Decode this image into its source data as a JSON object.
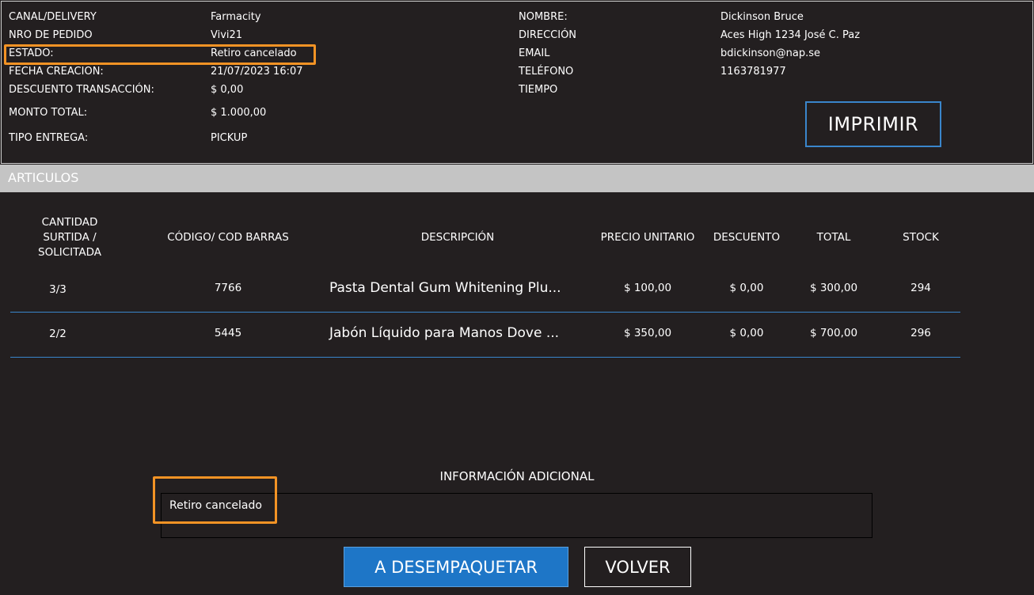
{
  "order": {
    "canal_label": "CANAL/DELIVERY",
    "canal_value": "Farmacity",
    "nro_label": "NRO DE PEDIDO",
    "nro_value": "Vivi21",
    "estado_label": "ESTADO:",
    "estado_value": "Retiro cancelado",
    "fecha_label": "FECHA CREACION:",
    "fecha_value": "21/07/2023 16:07",
    "descuento_label": "DESCUENTO TRANSACCIÓN:",
    "descuento_value": "$ 0,00",
    "monto_label": "MONTO TOTAL:",
    "monto_value": "$ 1.000,00",
    "tipo_label": "TIPO ENTREGA:",
    "tipo_value": "PICKUP"
  },
  "customer": {
    "nombre_label": "NOMBRE:",
    "nombre_value": "Dickinson Bruce",
    "direccion_label": "DIRECCIÓN",
    "direccion_value": "Aces High 1234 José C. Paz",
    "email_label": "EMAIL",
    "email_value": "bdickinson@nap.se",
    "telefono_label": "TELÉFONO",
    "telefono_value": "1163781977",
    "tiempo_label": "TIEMPO"
  },
  "print_button": "IMPRIMIR",
  "articles": {
    "section_title": "ARTICULOS",
    "headers": {
      "cantidad_1": "CANTIDAD",
      "cantidad_2": "SURTIDA /",
      "cantidad_3": "SOLICITADA",
      "codigo": "CÓDIGO/ COD BARRAS",
      "descripcion": "DESCRIPCIÓN",
      "precio": "PRECIO UNITARIO",
      "descuento": "DESCUENTO",
      "total": "TOTAL",
      "stock": "STOCK"
    },
    "rows": [
      {
        "cantidad": "3/3",
        "codigo": "7766",
        "descripcion": "Pasta Dental Gum Whitening Plu...",
        "precio": "$ 100,00",
        "descuento": "$ 0,00",
        "total": "$ 300,00",
        "stock": "294"
      },
      {
        "cantidad": "2/2",
        "codigo": "5445",
        "descripcion": "Jabón Líquido para Manos Dove ...",
        "precio": "$ 350,00",
        "descuento": "$ 0,00",
        "total": "$ 700,00",
        "stock": "296"
      }
    ]
  },
  "notes": {
    "label": "INFORMACIÓN ADICIONAL",
    "text": "Retiro cancelado"
  },
  "actions": {
    "unpack": "A DESEMPAQUETAR",
    "back": "VOLVER"
  },
  "colors": {
    "background": "#231f20",
    "highlight": "#f39325",
    "accent": "#1e76c7",
    "section_bar": "#c4c4c4"
  }
}
